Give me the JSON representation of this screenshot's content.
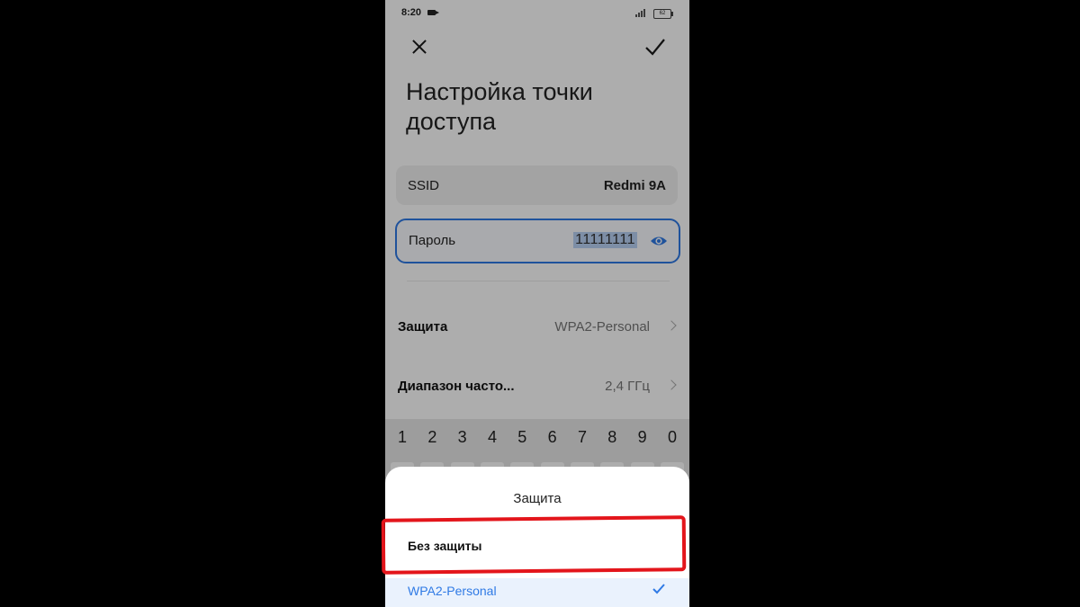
{
  "status_bar": {
    "time": "8:20",
    "battery": "62"
  },
  "title": "Настройка точки доступа",
  "ssid": {
    "label": "SSID",
    "value": "Redmi 9A"
  },
  "password": {
    "label": "Пароль",
    "value": "11111111"
  },
  "security_row": {
    "label": "Защита",
    "value": "WPA2-Personal"
  },
  "band_row": {
    "label": "Диапазон часто...",
    "value": "2,4 ГГц"
  },
  "keyboard": {
    "digits": [
      "1",
      "2",
      "3",
      "4",
      "5",
      "6",
      "7",
      "8",
      "9",
      "0"
    ]
  },
  "sheet": {
    "title": "Защита",
    "options": [
      {
        "label": "Без защиты",
        "selected": false
      },
      {
        "label": "WPA2-Personal",
        "selected": true
      }
    ]
  },
  "colors": {
    "accent": "#2f7ae5",
    "highlight_frame": "#e3151b"
  }
}
